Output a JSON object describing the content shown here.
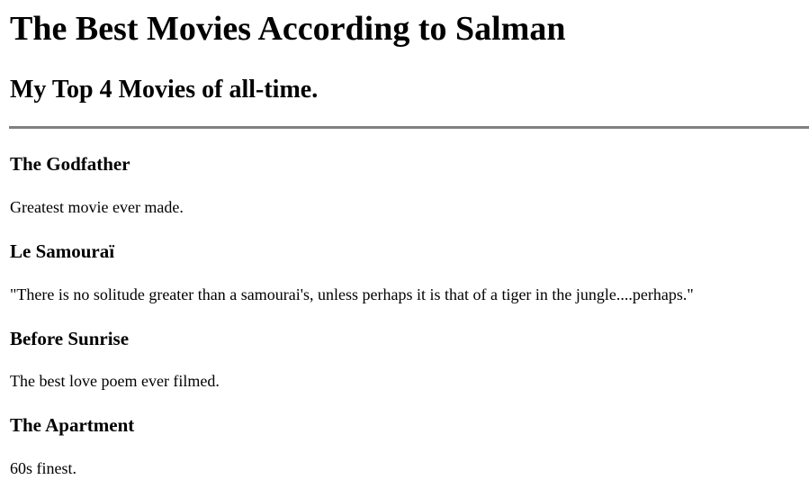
{
  "header": {
    "title": "The Best Movies According to Salman",
    "subtitle": "My Top 4 Movies of all-time."
  },
  "movies": [
    {
      "title": "The Godfather",
      "description": "Greatest movie ever made."
    },
    {
      "title": "Le Samouraï",
      "description": "\"There is no solitude greater than a samourai's, unless perhaps it is that of a tiger in the jungle....perhaps.\""
    },
    {
      "title": "Before Sunrise",
      "description": "The best love poem ever filmed."
    },
    {
      "title": "The Apartment",
      "description": "60s finest."
    }
  ],
  "colors": {
    "text": "#000000",
    "divider": "#808080",
    "background": "#ffffff"
  }
}
